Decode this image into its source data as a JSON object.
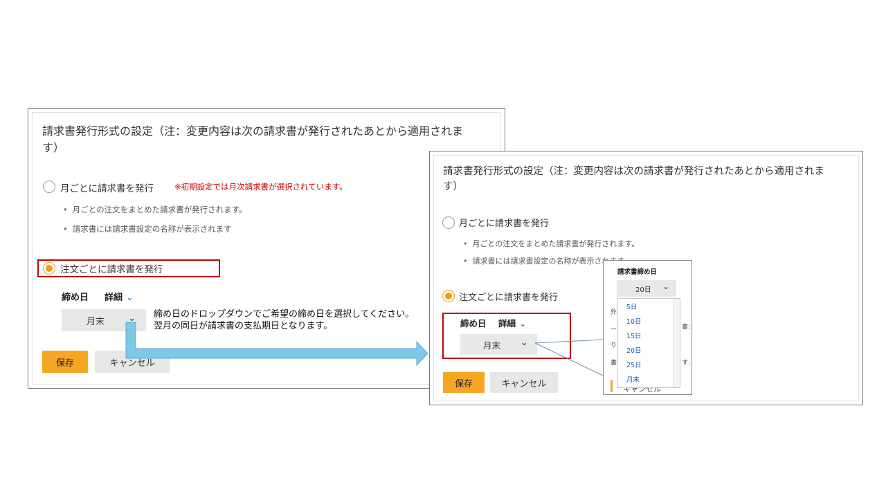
{
  "left_panel": {
    "title_line1": "請求書発行形式の設定（注：変更内容は次の請求書が発行されたあとから適用されま",
    "title_line2": "す）",
    "monthly_label": "月ごとに請求書を発行",
    "monthly_note": "※初期設定では月次請求書が選択されています。",
    "bullets": [
      "月ごとの注文をまとめた請求書が発行されます。",
      "請求書には請求書設定の名称が表示されます"
    ],
    "per_order_label": "注文ごとに請求書を発行",
    "closing_day_label": "締め日",
    "detail_label": "詳細",
    "select_value": "月末",
    "save_label": "保存",
    "cancel_label": "キャンセル"
  },
  "callout": {
    "line1": "締め日のドロップダウンでご希望の締め日を選択してください。",
    "line2": "翌月の同日が請求書の支払期日となります。"
  },
  "right_panel": {
    "title_line1": "請求書発行形式の設定（注：変更内容は次の請求書が発行されたあとから適用されま",
    "title_line2": "す）",
    "monthly_label": "月ごとに請求書を発行",
    "bullets": [
      "月ごとの注文をまとめた請求書が発行されます。",
      "請求書には請求書設定の名称が表示されます"
    ],
    "per_order_label": "注文ごとに請求書を発行",
    "closing_day_label": "締め日",
    "detail_label": "詳細",
    "select_value": "月末",
    "save_label": "保存",
    "cancel_label": "キャンセル"
  },
  "popup": {
    "title": "請求書締め日",
    "select_value": "20日",
    "options": [
      "5日",
      "10日",
      "15日",
      "20日",
      "25日",
      "月末"
    ],
    "fragments": [
      "外",
      "ー",
      "書:",
      "り",
      "書",
      "す.",
      "キャンセル"
    ]
  },
  "colors": {
    "accent": "#f5a623",
    "radio_selected": "#f39c12",
    "highlight_box": "#c00000",
    "arrow_fill": "#7ec8e8",
    "link_blue": "#1a6fbf"
  },
  "icons": {
    "chevron": "chevron-down-icon"
  }
}
